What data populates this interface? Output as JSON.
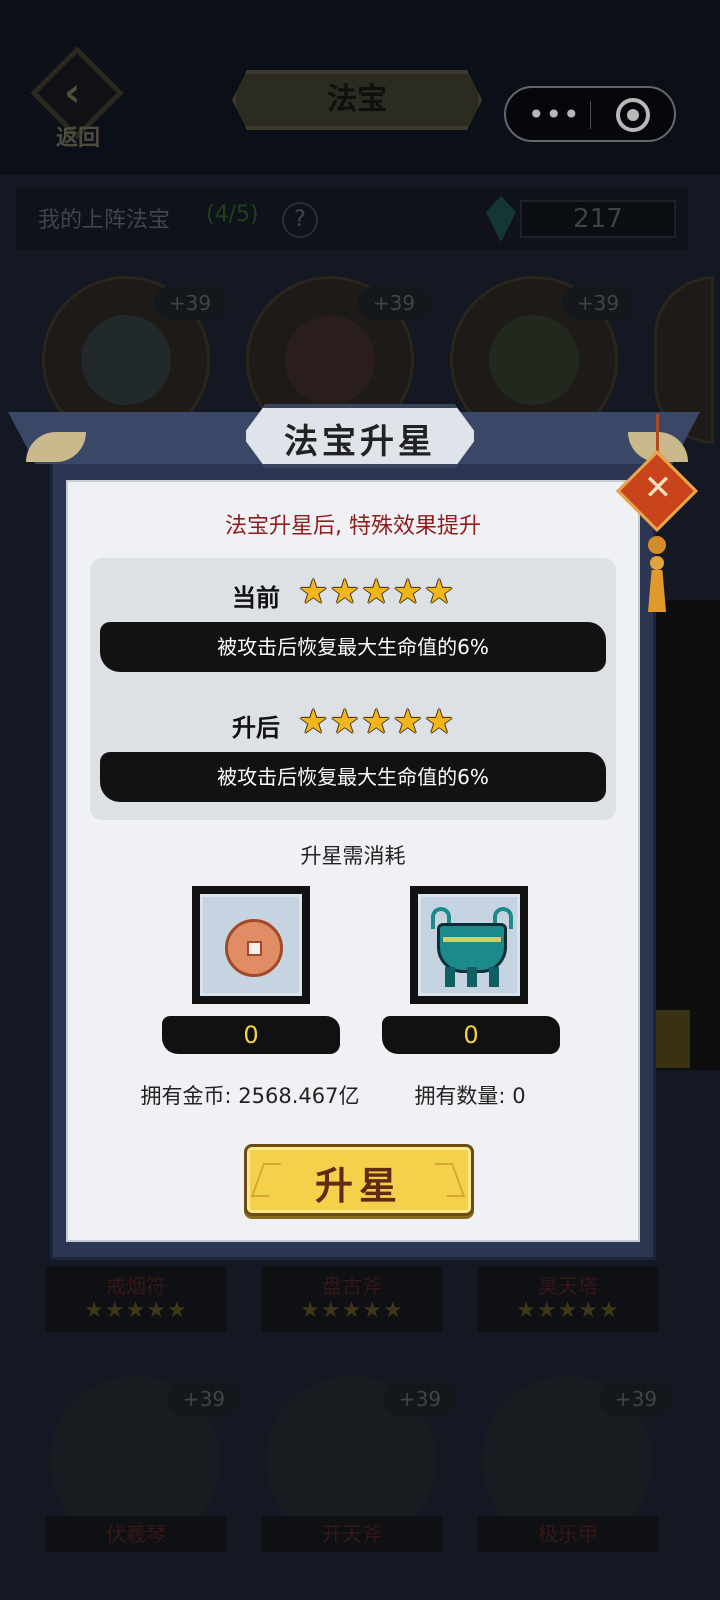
{
  "header": {
    "back_label": "返回",
    "page_title": "法宝",
    "capsule_more": "•••"
  },
  "slots": {
    "label": "我的上阵法宝",
    "count": "(4/5)",
    "help": "?",
    "gems": "217",
    "levels": [
      "+39",
      "+39",
      "+39"
    ]
  },
  "cards": [
    {
      "name": "戒烟符",
      "stars": "★★★★★"
    },
    {
      "name": "盘古斧",
      "stars": "★★★★★"
    },
    {
      "name": "昊天塔",
      "stars": "★★★★★"
    }
  ],
  "bottom_cards": [
    {
      "name": "伏羲琴",
      "level": "+39"
    },
    {
      "name": "开天斧",
      "level": "+39"
    },
    {
      "name": "极乐甲",
      "level": "+39"
    }
  ],
  "modal": {
    "title": "法宝升星",
    "close_symbol": "✕",
    "effect_title": "法宝升星后, 特殊效果提升",
    "current": {
      "label": "当前",
      "stars": "★★★★★",
      "rating": 5,
      "effect": "被攻击后恢复最大生命值的6%"
    },
    "after": {
      "label": "升后",
      "stars": "★★★★★",
      "rating": 5,
      "effect": "被攻击后恢复最大生命值的6%"
    },
    "cost_title": "升星需消耗",
    "costs": [
      {
        "icon": "copper-coin-icon",
        "count": "0",
        "own": "拥有金币: 2568.467亿"
      },
      {
        "icon": "bronze-ding-icon",
        "count": "0",
        "own": "拥有数量: 0"
      }
    ],
    "upgrade_button": "升星"
  },
  "colors": {
    "effect_title": "#8e1d1d",
    "star": "#f2b51c",
    "button": "#f4d14a",
    "count_text": "#f3d43c"
  }
}
